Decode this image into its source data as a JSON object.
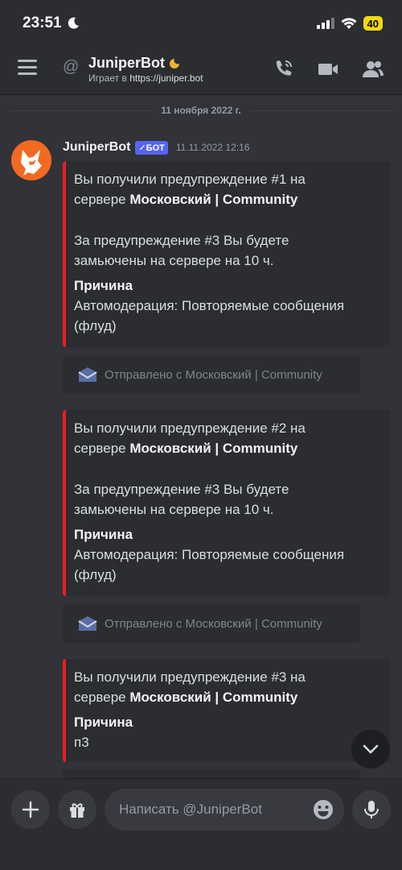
{
  "status_bar": {
    "time": "23:51",
    "battery": "40"
  },
  "header": {
    "title": "JuniperBot",
    "subtitle_prefix": "Играет в",
    "subtitle_link": "https://juniper.bot"
  },
  "chat": {
    "date_divider": "11 ноября 2022 г.",
    "author": "JuniperBot",
    "bot_tag": "✓БОТ",
    "timestamp": "11.11.2022 12:16",
    "embeds": [
      {
        "line1": "Вы получили предупреждение #1 на",
        "line2_prefix": "сервере ",
        "server": "Московский | Community",
        "note1": "За предупреждение #3 Вы будете",
        "note2": "замьючены на сервере на 10 ч.",
        "field_name": "Причина",
        "field_value1": "Автомодерация: Повторяемые сообщения",
        "field_value2": "(флуд)"
      },
      {
        "line1": "Вы получили предупреждение #2 на",
        "line2_prefix": "сервере ",
        "server": "Московский | Community",
        "note1": "За предупреждение #3 Вы будете",
        "note2": "замьючены на сервере на 10 ч.",
        "field_name": "Причина",
        "field_value1": "Автомодерация: Повторяемые сообщения",
        "field_value2": "(флуд)"
      },
      {
        "line1": "Вы получили предупреждение #3 на",
        "line2_prefix": "сервере ",
        "server": "Московский | Community",
        "field_name": "Причина",
        "field_value1": "п3"
      }
    ],
    "sent_from_label": "Отправлено с Московский | Community"
  },
  "composer": {
    "placeholder": "Написать @JuniperBot"
  },
  "colors": {
    "embed_border": "#ed1d24",
    "bot_tag": "#5865f2",
    "background": "#313338"
  }
}
